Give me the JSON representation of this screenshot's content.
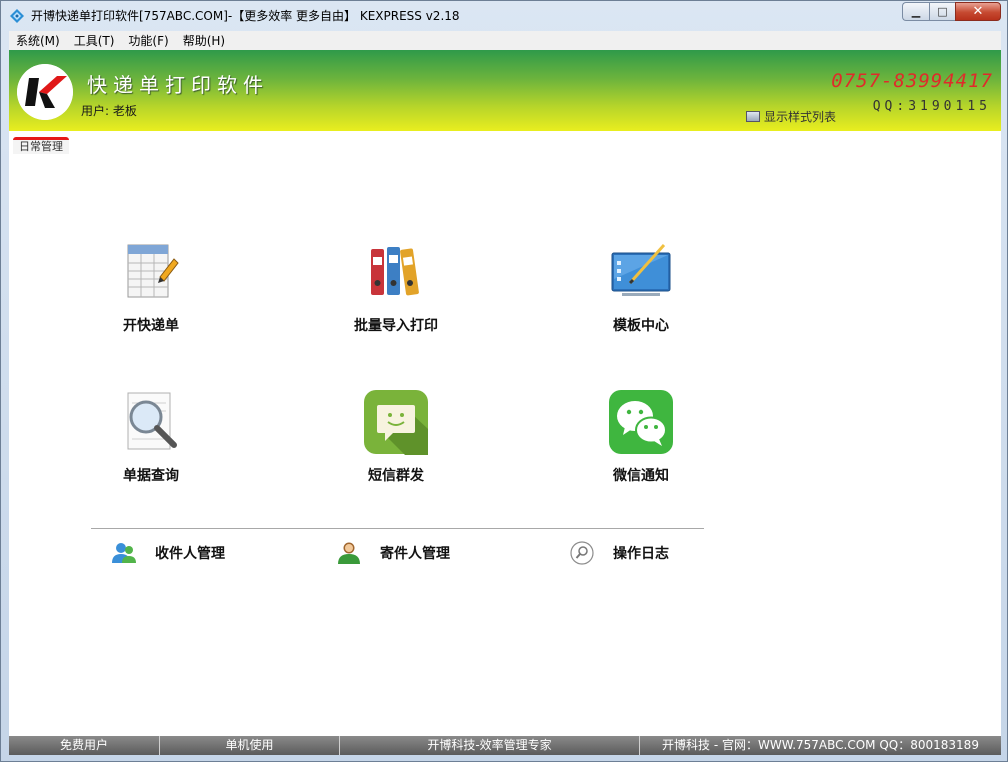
{
  "window": {
    "title": "开博快递单打印软件[757ABC.COM]-【更多效率 更多自由】  KEXPRESS v2.18",
    "minimize_label": "▁",
    "maximize_label": "□",
    "close_label": "✕"
  },
  "menu": {
    "items": [
      {
        "label": "系统(M)"
      },
      {
        "label": "工具(T)"
      },
      {
        "label": "功能(F)"
      },
      {
        "label": "帮助(H)"
      }
    ]
  },
  "header": {
    "app_name": "快递单打印软件",
    "user": "用户: 老板",
    "phone": "0757-83994417",
    "qq": "QQ:3190115",
    "style_list_label": "显示样式列表",
    "colors": {
      "top": "#2f9a4a",
      "bottom": "#e9ee1f",
      "phone": "#e02a2a"
    }
  },
  "tab": {
    "label": "日常管理",
    "accent": "#e51919"
  },
  "tiles": [
    {
      "label": "开快递单",
      "icon": "spreadsheet-pen-icon"
    },
    {
      "label": "批量导入打印",
      "icon": "binders-icon"
    },
    {
      "label": "模板中心",
      "icon": "template-board-icon"
    },
    {
      "label": "单据查询",
      "icon": "magnifier-icon"
    },
    {
      "label": "短信群发",
      "icon": "sms-bubble-icon"
    },
    {
      "label": "微信通知",
      "icon": "wechat-icon"
    }
  ],
  "links": [
    {
      "label": "收件人管理",
      "icon": "users-icon"
    },
    {
      "label": "寄件人管理",
      "icon": "user-icon"
    },
    {
      "label": "操作日志",
      "icon": "search-log-icon"
    }
  ],
  "status": [
    {
      "text": "免费用户"
    },
    {
      "text": "单机使用"
    },
    {
      "text": "开博科技-效率管理专家"
    },
    {
      "text": "开博科技 - 官网：WWW.757ABC.COM  QQ：800183189"
    }
  ]
}
